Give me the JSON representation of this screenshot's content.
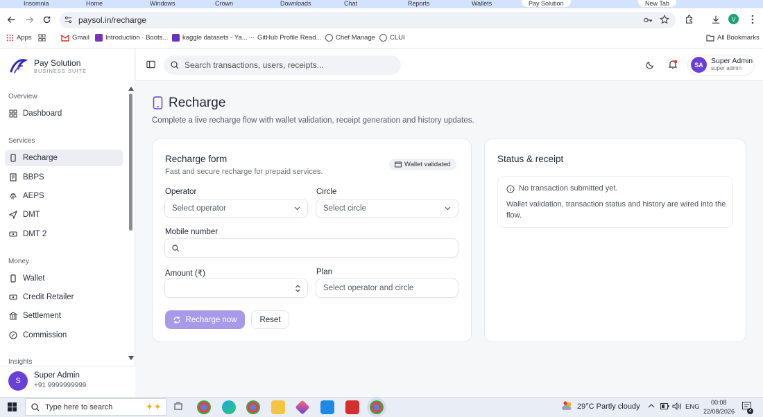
{
  "browser": {
    "tabs": [
      "Insomnia",
      "Home",
      "Windows",
      "Crown",
      "Downloads",
      "Chat",
      "Reports",
      "Wallets",
      "Pay Solution",
      "New Tab"
    ],
    "url": "paysol.in/recharge",
    "bookmarks": [
      "Apps",
      "Gmail",
      "Introduction · Boots...",
      "kaggle datasets - Ya...",
      "GitHub Profile Read...",
      "Chef Manage",
      "CLUI"
    ],
    "all_bookmarks": "All Bookmarks",
    "profile_initial": "V"
  },
  "brand": {
    "title": "Pay Solution",
    "subtitle": "BUSINESS SUITE"
  },
  "sidebar": {
    "sections": [
      {
        "label": "Overview",
        "items": [
          {
            "label": "Dashboard",
            "icon": "dashboard-icon"
          }
        ]
      },
      {
        "label": "Services",
        "items": [
          {
            "label": "Recharge",
            "icon": "phone-icon",
            "active": true
          },
          {
            "label": "BBPS",
            "icon": "receipt-icon"
          },
          {
            "label": "AEPS",
            "icon": "fingerprint-icon"
          },
          {
            "label": "DMT",
            "icon": "send-icon"
          },
          {
            "label": "DMT 2",
            "icon": "transfer-icon"
          }
        ]
      },
      {
        "label": "Money",
        "items": [
          {
            "label": "Wallet",
            "icon": "wallet-icon"
          },
          {
            "label": "Credit Retailer",
            "icon": "credit-icon"
          },
          {
            "label": "Settlement",
            "icon": "bank-icon"
          },
          {
            "label": "Commission",
            "icon": "percent-icon"
          }
        ]
      },
      {
        "label": "Insights",
        "items": []
      }
    ],
    "user": {
      "initial": "S",
      "name": "Super Admin",
      "phone": "+91 9999999999"
    }
  },
  "topbar": {
    "search_placeholder": "Search transactions, users, receipts...",
    "user": {
      "initials": "SA",
      "name": "Super Admin",
      "role": "super admin"
    }
  },
  "page": {
    "title": "Recharge",
    "description": "Complete a live recharge flow with wallet validation, receipt generation and history updates."
  },
  "form": {
    "title": "Recharge form",
    "subtitle": "Fast and secure recharge for prepaid services.",
    "badge": "Wallet validated",
    "operator_label": "Operator",
    "operator_value": "Select operator",
    "circle_label": "Circle",
    "circle_value": "Select circle",
    "mobile_label": "Mobile number",
    "mobile_value": "",
    "amount_label": "Amount (₹)",
    "amount_value": "",
    "plan_label": "Plan",
    "plan_placeholder": "Select operator and circle",
    "submit_label": "Recharge now",
    "reset_label": "Reset"
  },
  "status": {
    "title": "Status & receipt",
    "message": "No transaction submitted yet.",
    "note": "Wallet validation, transaction status and history are wired into the flow."
  },
  "taskbar": {
    "search_placeholder": "Type here to search",
    "weather": "29°C  Partly cloudy",
    "language": "ENG",
    "time": "00:08",
    "date": "22/08/2026",
    "notification_count": "4"
  },
  "colors": {
    "accent": "#6a3fd8",
    "primary_button": "#a89ae8",
    "notification": "#e53935"
  }
}
